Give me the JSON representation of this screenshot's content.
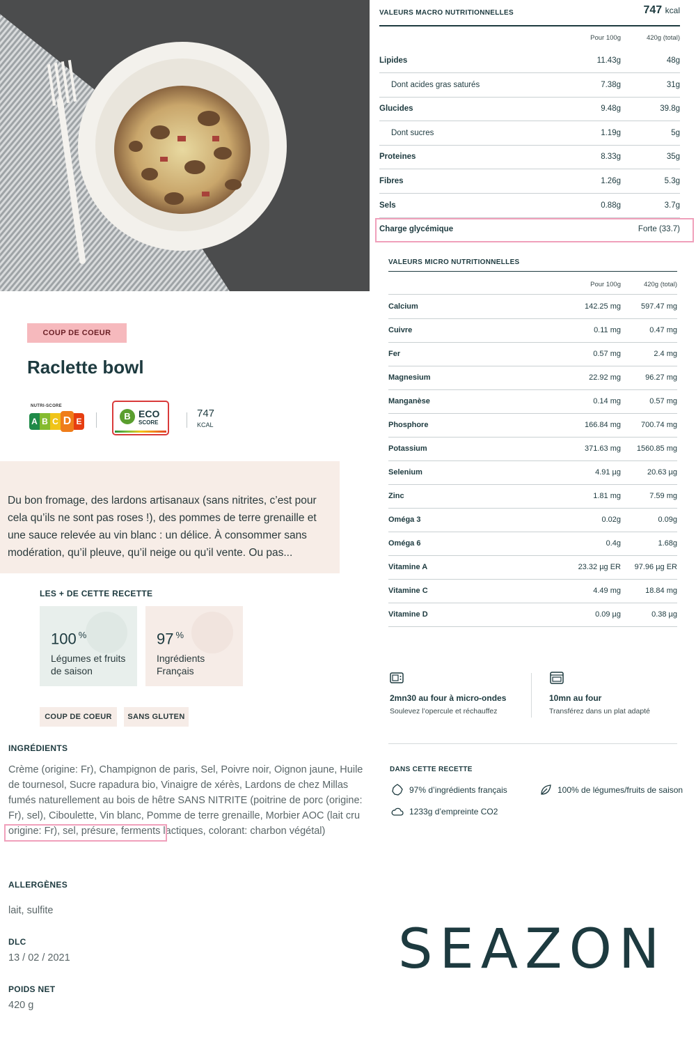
{
  "product": {
    "badge": "COUP DE COEUR",
    "title": "Raclette bowl",
    "nutri_score_label": "NUTRI-SCORE",
    "nutri_score_letters": [
      "A",
      "B",
      "C",
      "D",
      "E"
    ],
    "nutri_score_selected": "D",
    "eco_score_letter": "B",
    "eco_score_word": "ECO",
    "eco_score_sub": "SCORE",
    "kcal_value": "747",
    "kcal_unit": "KCAL",
    "description": "Du bon fromage, des lardons artisanaux (sans nitrites, c’est pour cela qu’ils ne sont pas roses !), des pommes de terre grenaille et une sauce relevée au vin blanc : un délice. À consommer sans modération, qu’il pleuve, qu’il neige ou qu’il vente. Ou pas..."
  },
  "plus": {
    "heading": "LES + DE CETTE RECETTE",
    "cards": [
      {
        "value": "100",
        "unit": "%",
        "text": "Légumes et fruits de saison"
      },
      {
        "value": "97",
        "unit": "%",
        "text": "Ingrédients Français"
      }
    ],
    "tags": [
      "COUP DE COEUR",
      "SANS GLUTEN"
    ]
  },
  "ingredients": {
    "heading": "INGRÉDIENTS",
    "text": "Crème (origine: Fr), Champignon de paris, Sel, Poivre noir, Oignon jaune, Huile de tournesol, Sucre rapadura bio, Vinaigre de xérès, Lardons de chez Millas fumés naturellement au bois de hêtre SANS NITRITE (poitrine de porc (origine: Fr), sel), Ciboulette, Vin blanc, Pomme de terre grenaille, Morbier AOC (lait cru origine: Fr), sel, présure, ferments lactiques, colorant: charbon végétal)"
  },
  "allergens": {
    "heading": "ALLERGÈNES",
    "text": "lait, sulfite"
  },
  "dlc": {
    "heading": "DLC",
    "text": "13 / 02 / 2021"
  },
  "weight": {
    "heading": "POIDS NET",
    "text": "420 g"
  },
  "macro": {
    "heading": "VALEURS MACRO NUTRITIONNELLES",
    "kcal_value": "747",
    "kcal_unit": "kcal",
    "col1": "Pour 100g",
    "col2": "420g (total)",
    "rows": [
      {
        "label": "Lipides",
        "v1": "11.43g",
        "v2": "48g",
        "sub": false
      },
      {
        "label": "Dont acides gras saturés",
        "v1": "7.38g",
        "v2": "31g",
        "sub": true
      },
      {
        "label": "Glucides",
        "v1": "9.48g",
        "v2": "39.8g",
        "sub": false
      },
      {
        "label": "Dont sucres",
        "v1": "1.19g",
        "v2": "5g",
        "sub": true
      },
      {
        "label": "Proteines",
        "v1": "8.33g",
        "v2": "35g",
        "sub": false
      },
      {
        "label": "Fibres",
        "v1": "1.26g",
        "v2": "5.3g",
        "sub": false
      },
      {
        "label": "Sels",
        "v1": "0.88g",
        "v2": "3.7g",
        "sub": false
      },
      {
        "label": "Charge glycémique",
        "v1": "",
        "v2": "Forte (33.7)",
        "sub": false
      }
    ]
  },
  "micro": {
    "heading": "VALEURS MICRO NUTRITIONNELLES",
    "col1": "Pour 100g",
    "col2": "420g (total)",
    "rows": [
      {
        "label": "Calcium",
        "v1": "142.25 mg",
        "v2": "597.47 mg"
      },
      {
        "label": "Cuivre",
        "v1": "0.11 mg",
        "v2": "0.47 mg"
      },
      {
        "label": "Fer",
        "v1": "0.57 mg",
        "v2": "2.4 mg"
      },
      {
        "label": "Magnesium",
        "v1": "22.92 mg",
        "v2": "96.27 mg"
      },
      {
        "label": "Manganèse",
        "v1": "0.14 mg",
        "v2": "0.57 mg"
      },
      {
        "label": "Phosphore",
        "v1": "166.84 mg",
        "v2": "700.74 mg"
      },
      {
        "label": "Potassium",
        "v1": "371.63 mg",
        "v2": "1560.85 mg"
      },
      {
        "label": "Selenium",
        "v1": "4.91 µg",
        "v2": "20.63 µg"
      },
      {
        "label": "Zinc",
        "v1": "1.81 mg",
        "v2": "7.59 mg"
      },
      {
        "label": "Oméga 3",
        "v1": "0.02g",
        "v2": "0.09g"
      },
      {
        "label": "Oméga 6",
        "v1": "0.4g",
        "v2": "1.68g"
      },
      {
        "label": "Vitamine A",
        "v1": "23.32 µg ER",
        "v2": "97.96 µg ER"
      },
      {
        "label": "Vitamine C",
        "v1": "4.49 mg",
        "v2": "18.84 mg"
      },
      {
        "label": "Vitamine D",
        "v1": "0.09 µg",
        "v2": "0.38 µg"
      }
    ]
  },
  "cooking": [
    {
      "icon": "microwave-icon",
      "title": "2mn30 au four à micro-ondes",
      "subtitle": "Soulevez l’opercule et réchauffez"
    },
    {
      "icon": "oven-icon",
      "title": "10mn au four",
      "subtitle": "Transférez dans un plat adapté"
    }
  ],
  "recipe": {
    "heading": "DANS CETTE RECETTE",
    "items": [
      {
        "icon": "france-map-icon",
        "text": "97%  d’ingrédients français"
      },
      {
        "icon": "leaf-icon",
        "text": "100%  de légumes/fruits de saison"
      },
      {
        "icon": "cloud-icon",
        "text": "1233g  d’empreinte CO2"
      }
    ]
  },
  "brand": {
    "logo": "SEAZON"
  },
  "colors": {
    "primary": "#1d3a3f",
    "highlight": "#f0a0bb",
    "badge": "#f6b9bd",
    "cream": "#f7ede7"
  }
}
